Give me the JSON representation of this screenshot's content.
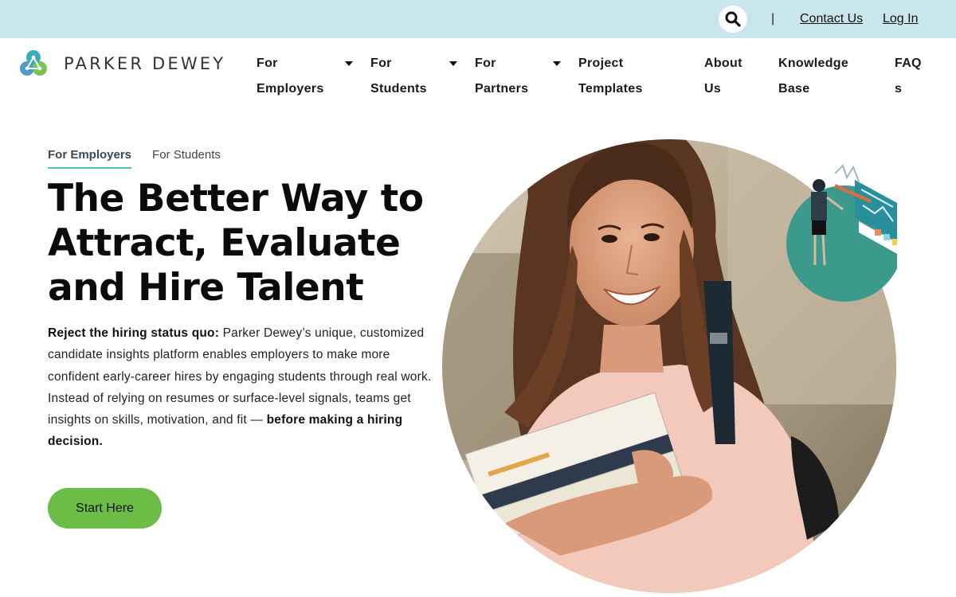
{
  "topbar": {
    "separator": "|",
    "contact_label": "Contact Us",
    "login_label": "Log In",
    "icon": "search-icon"
  },
  "brand": {
    "name": "PARKER DEWEY",
    "icon": "parker-dewey-logo-icon",
    "colors": {
      "teal": "#3aa6b9",
      "green": "#6cbd45",
      "blue": "#2f6f9f"
    }
  },
  "nav": {
    "employers": {
      "line1": "For",
      "line2": "Employers"
    },
    "students": {
      "line1": "For",
      "line2": "Students"
    },
    "partners": {
      "line1": "For",
      "line2": "Partners"
    },
    "templates": {
      "line1": "Project",
      "line2": "Templates"
    },
    "about": {
      "line1": "About",
      "line2": "Us"
    },
    "knowledge": {
      "line1": "Knowledge",
      "line2": "Base"
    },
    "faq": {
      "line1": "FAQ",
      "line2": "s"
    }
  },
  "hero": {
    "tabs": [
      "For Employers",
      "For Students"
    ],
    "active_tab": "For Employers",
    "title_lines": [
      "The Better Way to",
      "Attract, Evaluate",
      "and Hire Talent"
    ],
    "body_lead": "Reject the hiring status quo:",
    "body_text": " Parker Dewey’s unique, customized candidate insights platform enables employers to make more confident early-career hires by engaging students through real work. Instead of relying on resumes or surface-level signals, teams get insights on skills, motivation, and fit — ",
    "body_emphasis": "before making a hiring decision.",
    "cta_label": "Start Here"
  },
  "colors": {
    "topbar_bg": "#c9e6ec",
    "cta_bg": "#6cbd45",
    "tab_underline": "#4db8d0"
  }
}
